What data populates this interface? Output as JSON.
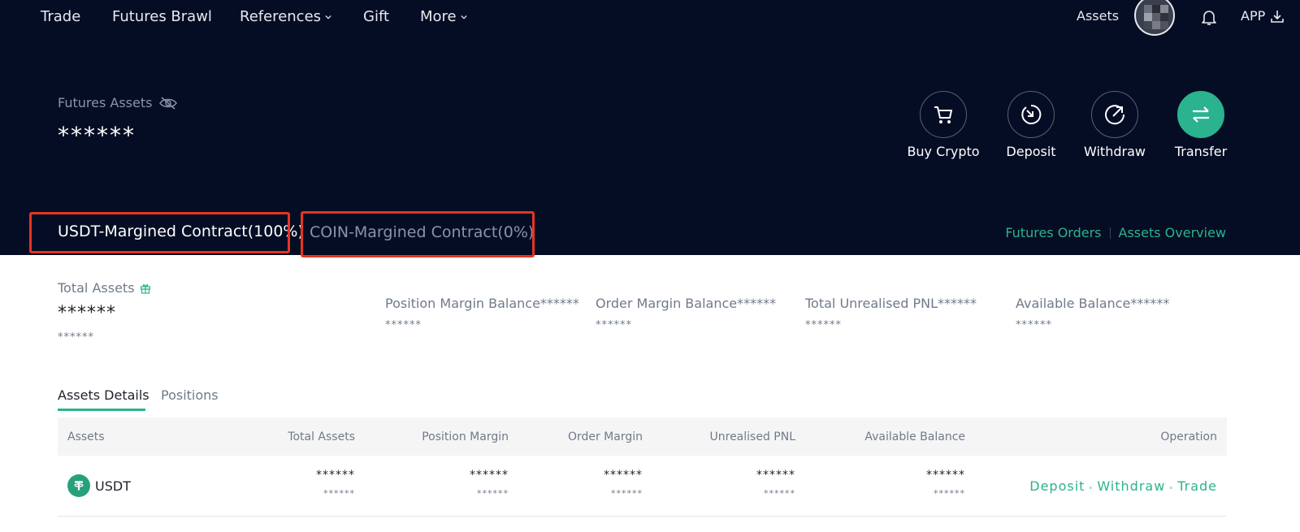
{
  "nav": {
    "items": [
      {
        "label": "Trade"
      },
      {
        "label": "Futures Brawl"
      },
      {
        "label": "References"
      },
      {
        "label": "Gift"
      },
      {
        "label": "More"
      }
    ],
    "assets_label": "Assets",
    "app_label": "APP"
  },
  "overview": {
    "label": "Futures Assets",
    "value": "******"
  },
  "actions": [
    {
      "label": "Buy Crypto",
      "icon": "cart-icon"
    },
    {
      "label": "Deposit",
      "icon": "deposit-icon"
    },
    {
      "label": "Withdraw",
      "icon": "withdraw-icon"
    },
    {
      "label": "Transfer",
      "icon": "transfer-icon"
    }
  ],
  "contract_tabs": {
    "usdt": "USDT-Margined Contract(100%)",
    "coin": "COIN-Margined Contract(0%)"
  },
  "header_links": {
    "orders": "Futures Orders",
    "overview": "Assets Overview"
  },
  "summary": {
    "total_label": "Total Assets",
    "total_value": "******",
    "total_sub": "******",
    "metrics": [
      {
        "label": "Position Margin Balance******",
        "sub": "******"
      },
      {
        "label": "Order Margin Balance******",
        "sub": "******"
      },
      {
        "label": "Total Unrealised PNL******",
        "sub": "******"
      },
      {
        "label": "Available Balance******",
        "sub": "******"
      }
    ]
  },
  "detail_tabs": {
    "active": "Assets Details",
    "inactive": "Positions"
  },
  "table": {
    "headers": [
      "Assets",
      "Total Assets",
      "Position Margin",
      "Order Margin",
      "Unrealised PNL",
      "Available Balance",
      "Operation"
    ],
    "rows": [
      {
        "coin": "USDT",
        "total": {
          "v1": "******",
          "v2": "******"
        },
        "position_margin": {
          "v1": "******",
          "v2": "******"
        },
        "order_margin": {
          "v1": "******",
          "v2": "******"
        },
        "unrealised_pnl": {
          "v1": "******",
          "v2": "******"
        },
        "available": {
          "v1": "******",
          "v2": "******"
        },
        "ops": [
          "Deposit",
          "Withdraw",
          "Trade"
        ]
      }
    ]
  },
  "colors": {
    "header_bg": "#050d24",
    "accent": "#2ab38e",
    "highlight_box": "#e53522"
  }
}
